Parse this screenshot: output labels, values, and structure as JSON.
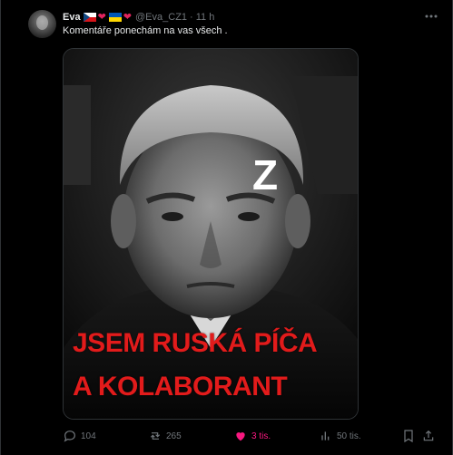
{
  "tweet": {
    "display_name": "Eva",
    "handle": "@Eva_CZ1",
    "separator": "·",
    "time": "11 h",
    "text": "Komentáře ponechám na vas všech .",
    "more_icon": "more-horizontal-icon",
    "badges": [
      "flag-czech-icon",
      "heart-red-icon",
      "flag-ukraine-icon",
      "heart-red-icon"
    ]
  },
  "media": {
    "overlay_letter": "Z",
    "caption_line1": "JSEM RUSKÁ PÍČA",
    "caption_line2": "A KOLABORANT",
    "caption_color": "#e21b1b"
  },
  "actions": {
    "replies": "104",
    "reposts": "265",
    "likes": "3 tis.",
    "views": "50 tis.",
    "like_color": "#f91880"
  },
  "colors": {
    "background": "#000000",
    "text_primary": "#e7e9ea",
    "text_secondary": "#71767b",
    "border": "#2f3336"
  }
}
